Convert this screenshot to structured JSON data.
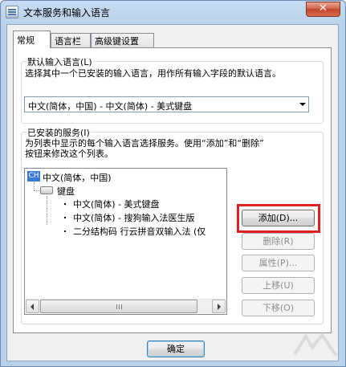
{
  "window": {
    "title": "文本服务和输入语言",
    "close_label": "✕"
  },
  "tabs": [
    {
      "label": "常规",
      "active": true
    },
    {
      "label": "语言栏",
      "active": false
    },
    {
      "label": "高级键设置",
      "active": false
    }
  ],
  "default_language": {
    "group_label": "默认输入语言(L)",
    "description": "选择其中一个已安装的输入语言，用作所有输入字段的默认语言。",
    "selected": "中文(简体，中国) - 中文(简体) - 美式键盘"
  },
  "installed_services": {
    "group_label": "已安装的服务(I)",
    "description_line1": "为列表中显示的每个输入语言选择服务。使用“添加”和“删除”",
    "description_line2": "按钮来修改这个列表。",
    "tree": {
      "language_badge": "CH",
      "language": "中文(简体，中国)",
      "category": "键盘",
      "items": [
        "中文(简体) - 美式键盘",
        "中文(简体) - 搜狗输入法医生版",
        "二分结构码 行云拼音双输入法 (仅"
      ]
    },
    "buttons": {
      "add": "添加(D)...",
      "remove": "删除(R)",
      "properties": "属性(P)...",
      "move_up": "上移(U)",
      "move_down": "下移(O)"
    }
  },
  "footer": {
    "ok": "确定"
  },
  "colors": {
    "highlight": "#e02020",
    "badge": "#3a7bd5"
  }
}
